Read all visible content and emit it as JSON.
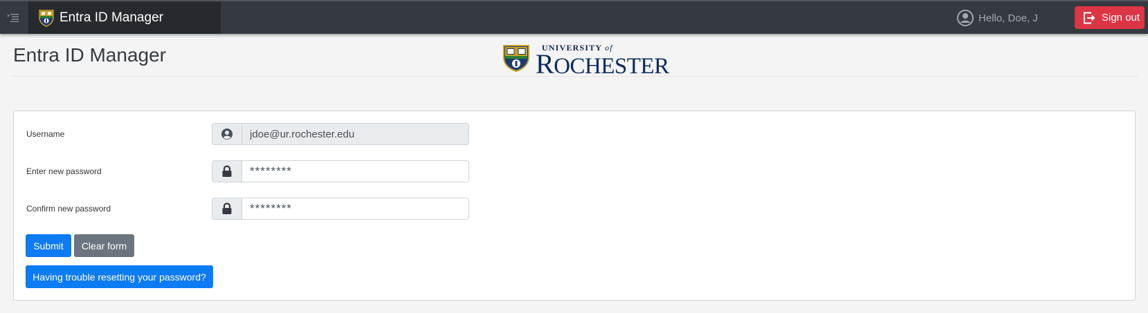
{
  "navbar": {
    "toggle_icon": "menu-collapse-icon",
    "brand_title": "Entra ID Manager",
    "user_greeting": "Hello, Doe, J",
    "signout_label": "Sign out",
    "signout_color": "#dc3545"
  },
  "header": {
    "title": "Entra ID Manager",
    "logo": {
      "university": "UNIVERSITY",
      "of": "of",
      "name_first": "R",
      "name_rest": "OCHESTER"
    }
  },
  "form": {
    "username": {
      "label": "Username",
      "value": "jdoe@ur.rochester.edu",
      "icon": "user-circle-icon"
    },
    "new_password": {
      "label": "Enter new password",
      "value": "********",
      "icon": "lock-icon"
    },
    "confirm_password": {
      "label": "Confirm new password",
      "value": "********",
      "icon": "lock-icon"
    },
    "submit_label": "Submit",
    "clear_label": "Clear form",
    "help_label": "Having trouble resetting your password?"
  },
  "colors": {
    "primary": "#0d7bf2",
    "secondary": "#6c757d",
    "navbar": "#343a40"
  }
}
